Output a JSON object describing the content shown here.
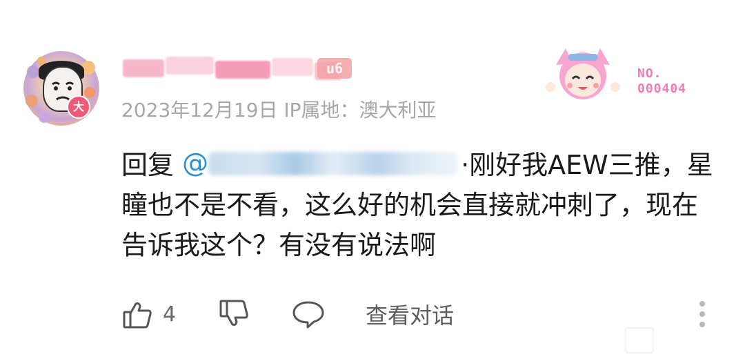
{
  "comment": {
    "user": {
      "name_blurred": true,
      "level_badge": "u6",
      "avatar_badge": "大"
    },
    "meta_text": "2023年12月19日 IP属地：澳大利亚",
    "sticker": {
      "number_label_line1": "NO.",
      "number_label_line2": "000404"
    },
    "content": {
      "reply_prefix": "回复 ",
      "mention_symbol": "@",
      "mention_blurred": true,
      "body_first_line": "·刚好我AEW三",
      "body_rest": "推，星瞳也不是不看，这么好的机会直接就冲刺了，现在告诉我这个？有没有说法啊"
    },
    "actions": {
      "likes_count": "4",
      "view_conversation_label": "查看对话"
    }
  },
  "colors": {
    "meta": "#a7a7a7",
    "mention": "#2a8fd0",
    "badge": "#f0587a",
    "level": "#f4a3a7",
    "number_tag": "#f07ab8"
  },
  "icons": [
    "thumbs-up-icon",
    "thumbs-down-icon",
    "comment-bubble-icon",
    "more-vertical-icon"
  ]
}
